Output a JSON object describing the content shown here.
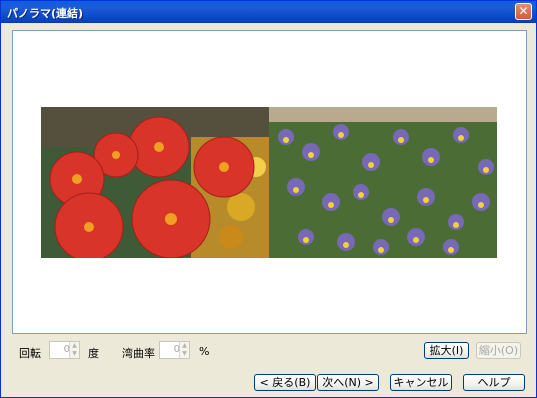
{
  "window": {
    "title": "パノラマ(連結)"
  },
  "controls": {
    "rotate_label": "回転",
    "rotate_value": "0",
    "rotate_unit": "度",
    "curvature_label": "湾曲率",
    "curvature_value": "0",
    "curvature_unit": "%"
  },
  "buttons": {
    "zoom_in": "拡大(I)",
    "zoom_out": "縮小(O)",
    "back": "< 戻る(B)",
    "next": "次へ(N) >",
    "cancel": "キャンセル",
    "help": "ヘルプ"
  },
  "image": {
    "left_subject": "red-dahlias",
    "right_subject": "pansies"
  },
  "icons": {
    "close": "close-icon",
    "spin_up": "up-arrow-icon",
    "spin_down": "down-arrow-icon"
  },
  "colors": {
    "titlebar": "#0a5fe0",
    "dialog_bg": "#ece9d8",
    "close": "#d8583a"
  }
}
